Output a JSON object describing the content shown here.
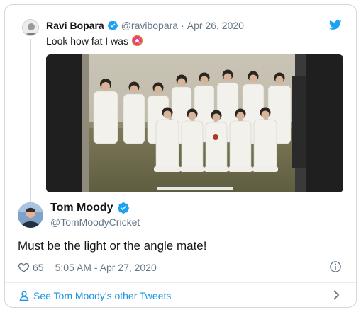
{
  "quoted_tweet": {
    "author_name": "Ravi Bopara",
    "author_handle": "@ravibopara",
    "date": "Apr 26, 2020",
    "separator": "·",
    "text": "Look how fat I was",
    "emoji_icon": "donut-emoji",
    "media_icon": "team-photo"
  },
  "tweet": {
    "author_name": "Tom Moody",
    "author_handle": "@TomMoodyCricket",
    "text": "Must be the light or the angle mate!",
    "likes": "65",
    "time": "5:05 AM - Apr 27, 2020"
  },
  "footer": {
    "more_tweets_label": "See Tom Moody's other Tweets"
  },
  "colors": {
    "accent": "#1da1f2",
    "link": "#1b95e0",
    "muted": "#657786",
    "border": "#cfd9de"
  }
}
